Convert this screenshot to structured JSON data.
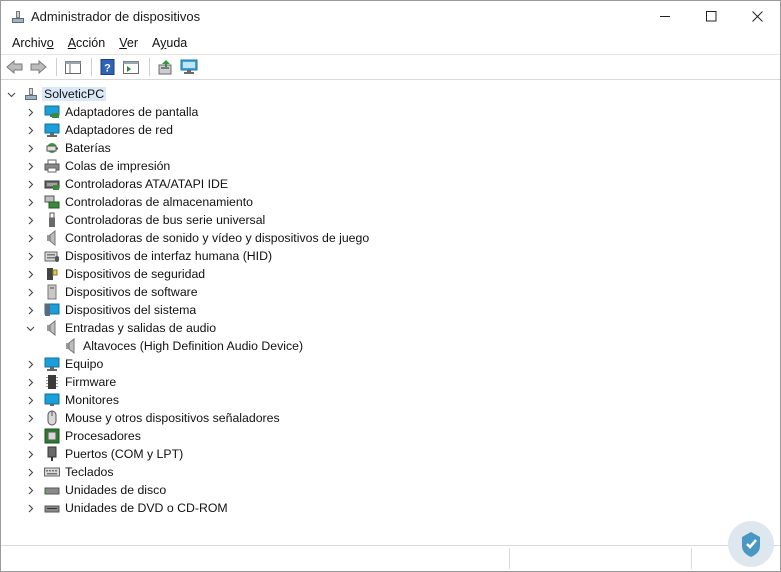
{
  "window": {
    "title": "Administrador de dispositivos"
  },
  "menu": [
    {
      "label": "Archivo"
    },
    {
      "label": "Acción"
    },
    {
      "label": "Ver"
    },
    {
      "label": "Ayuda"
    }
  ],
  "tree": {
    "root": "SolveticPC",
    "categories": [
      {
        "label": "Adaptadores de pantalla",
        "icon": "monitor-display-icon"
      },
      {
        "label": "Adaptadores de red",
        "icon": "network-adapter-icon"
      },
      {
        "label": "Baterías",
        "icon": "battery-icon"
      },
      {
        "label": "Colas de impresión",
        "icon": "printer-icon"
      },
      {
        "label": "Controladoras ATA/ATAPI IDE",
        "icon": "ide-controller-icon"
      },
      {
        "label": "Controladoras de almacenamiento",
        "icon": "storage-controller-icon"
      },
      {
        "label": "Controladoras de bus serie universal",
        "icon": "usb-icon"
      },
      {
        "label": "Controladoras de sonido y vídeo y dispositivos de juego",
        "icon": "speaker-icon"
      },
      {
        "label": "Dispositivos de interfaz humana (HID)",
        "icon": "hid-icon"
      },
      {
        "label": "Dispositivos de seguridad",
        "icon": "security-device-icon"
      },
      {
        "label": "Dispositivos de software",
        "icon": "software-device-icon"
      },
      {
        "label": "Dispositivos del sistema",
        "icon": "system-device-icon"
      },
      {
        "label": "Entradas y salidas de audio",
        "icon": "speaker-icon",
        "expanded": true,
        "children": [
          {
            "label": "Altavoces (High Definition Audio Device)",
            "icon": "speaker-icon"
          }
        ]
      },
      {
        "label": "Equipo",
        "icon": "computer-icon"
      },
      {
        "label": "Firmware",
        "icon": "firmware-icon"
      },
      {
        "label": "Monitores",
        "icon": "monitor-icon"
      },
      {
        "label": "Mouse y otros dispositivos señaladores",
        "icon": "mouse-icon"
      },
      {
        "label": "Procesadores",
        "icon": "processor-icon"
      },
      {
        "label": "Puertos (COM y LPT)",
        "icon": "port-icon"
      },
      {
        "label": "Teclados",
        "icon": "keyboard-icon"
      },
      {
        "label": "Unidades de disco",
        "icon": "disk-drive-icon"
      },
      {
        "label": "Unidades de DVD o CD-ROM",
        "icon": "dvd-drive-icon"
      }
    ]
  }
}
